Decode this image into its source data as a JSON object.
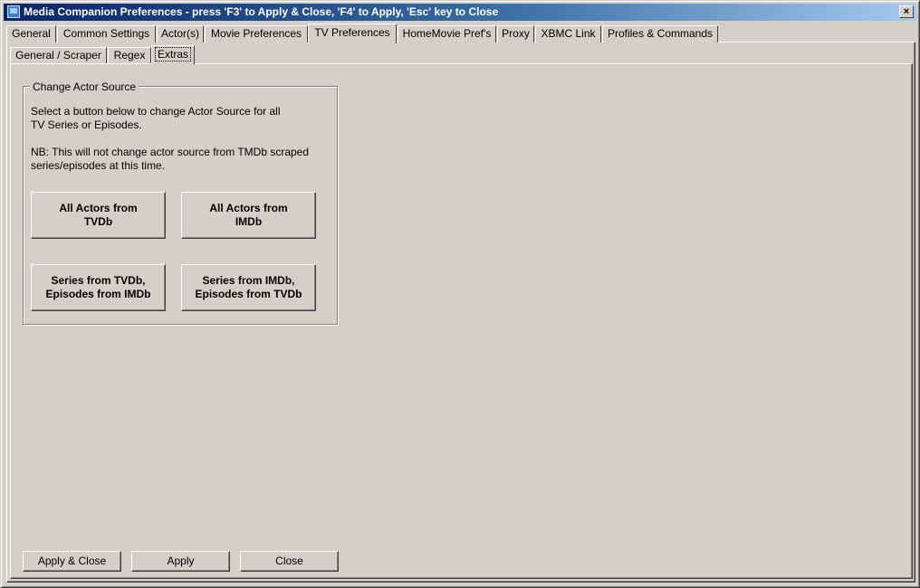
{
  "window": {
    "title": "Media Companion Preferences   -   press 'F3' to Apply & Close, 'F4' to Apply, 'Esc' key to Close",
    "close_label": "×"
  },
  "tabs": [
    {
      "label": "General"
    },
    {
      "label": "Common Settings"
    },
    {
      "label": "Actor(s)"
    },
    {
      "label": "Movie Preferences"
    },
    {
      "label": "TV Preferences",
      "active": true
    },
    {
      "label": "HomeMovie Pref's"
    },
    {
      "label": "Proxy"
    },
    {
      "label": "XBMC Link"
    },
    {
      "label": "Profiles & Commands"
    }
  ],
  "subtabs": [
    {
      "label": "General / Scraper"
    },
    {
      "label": "Regex"
    },
    {
      "label": "Extras",
      "active": true
    }
  ],
  "group": {
    "title": "Change Actor Source",
    "desc_line1": "Select a button below to change Actor Source for all",
    "desc_line2": "TV Series or Episodes.",
    "note_line1": "NB: This will not change actor source from TMDb scraped",
    "note_line2": "series/episodes at this time.",
    "buttons": [
      {
        "line1": "All Actors from",
        "line2": "TVDb"
      },
      {
        "line1": "All Actors from",
        "line2": "IMDb"
      },
      {
        "line1": "Series from TVDb,",
        "line2": "Episodes from IMDb"
      },
      {
        "line1": "Series from IMDb,",
        "line2": "Episodes from TVDb"
      }
    ]
  },
  "footer": {
    "apply_close": "Apply  &  Close",
    "apply": "Apply",
    "close": "Close"
  }
}
